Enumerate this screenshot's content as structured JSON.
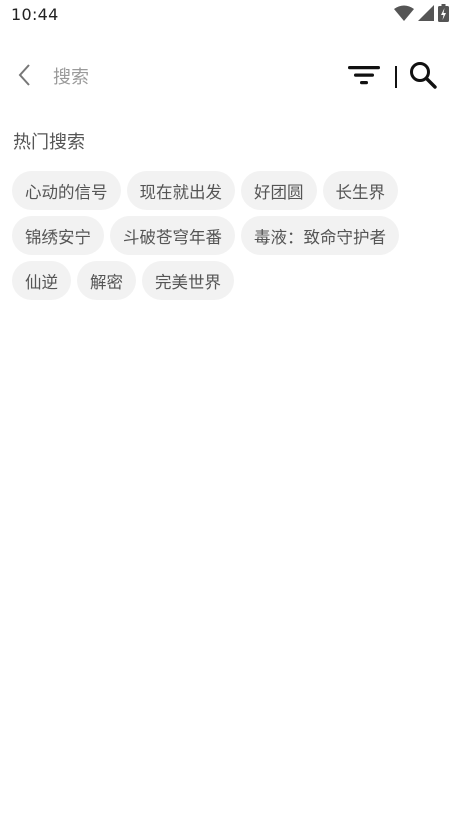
{
  "status_bar": {
    "time": "10:44",
    "icons": [
      "wifi-icon",
      "signal-icon",
      "battery-icon"
    ]
  },
  "header": {
    "back_icon": "chevron-left-icon",
    "search_placeholder": "搜索",
    "search_value": "",
    "filter_icon": "filter-icon",
    "search_icon": "search-icon"
  },
  "hot_search": {
    "title": "热门搜索",
    "tags": [
      "心动的信号",
      "现在就出发",
      "好团圆",
      "长生界",
      "锦绣安宁",
      "斗破苍穹年番",
      "毒液：致命守护者",
      "仙逆",
      "解密",
      "完美世界"
    ]
  },
  "colors": {
    "background": "#ffffff",
    "tag_background": "#f2f2f2",
    "tag_text": "#555555",
    "placeholder": "#9a9a9a",
    "icon": "#111111"
  }
}
